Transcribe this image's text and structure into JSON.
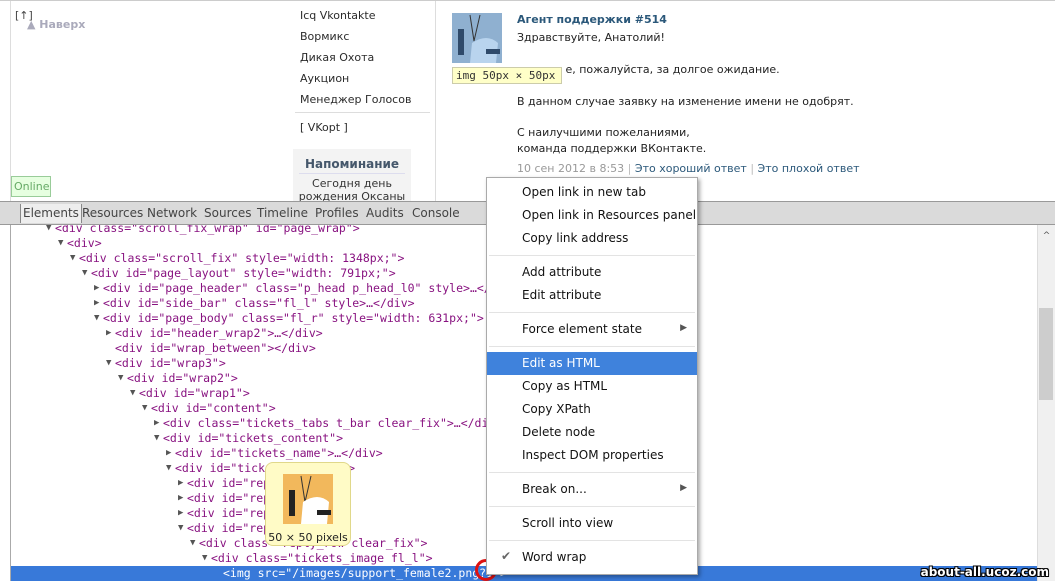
{
  "page": {
    "back_bracket": "[↑]",
    "back_label": "Наверх",
    "menu": [
      "Icq Vkontakte",
      "Вормикс",
      "Дикая Охота",
      "Аукцион",
      "Менеджер Голосов"
    ],
    "vkopt": "[ VKopt ]",
    "reminder_title": "Напоминание",
    "reminder_text": "Сегодня день рождения Оксаны",
    "online": "Online"
  },
  "message": {
    "author": "Агент поддержки #514",
    "lines": [
      "Здравствуйте, Анатолий!",
      "Извините, пожалуйста, за долгое ожидание.",
      "В данном случае заявку на изменение имени не одобрят.",
      "С наилучшими пожеланиями,",
      "команда поддержки ВКонтакте."
    ],
    "date": "10 сен 2012 в 8:53",
    "good": "Это хороший ответ",
    "bad": "Это плохой ответ",
    "img_size_tip": "img 50px × 50px"
  },
  "devtools": {
    "tabs": [
      "Elements",
      "Resources",
      "Network",
      "Sources",
      "Timeline",
      "Profiles",
      "Audits",
      "Console"
    ],
    "active_tab": "Elements",
    "lines": [
      {
        "d": 3,
        "a": "▼",
        "t": "<div class=\"scroll_fix_wrap\" id=\"page_wrap\">"
      },
      {
        "d": 4,
        "a": "▼",
        "t": "<div>"
      },
      {
        "d": 5,
        "a": "▼",
        "t": "<div class=\"scroll_fix\" style=\"width: 1348px;\">"
      },
      {
        "d": 6,
        "a": "▼",
        "t": "<div id=\"page_layout\" style=\"width: 791px;\">"
      },
      {
        "d": 7,
        "a": "▶",
        "t": "<div id=\"page_header\" class=\"p_head p_head_l0\" style>…</div>"
      },
      {
        "d": 7,
        "a": "▶",
        "t": "<div id=\"side_bar\" class=\"fl_l\" style>…</div>"
      },
      {
        "d": 7,
        "a": "▼",
        "t": "<div id=\"page_body\" class=\"fl_r\" style=\"width: 631px;\">"
      },
      {
        "d": 8,
        "a": "▶",
        "t": "<div id=\"header_wrap2\">…</div>"
      },
      {
        "d": 8,
        "a": "",
        "t": "<div id=\"wrap_between\"></div>"
      },
      {
        "d": 8,
        "a": "▼",
        "t": "<div id=\"wrap3\">"
      },
      {
        "d": 9,
        "a": "▼",
        "t": "<div id=\"wrap2\">"
      },
      {
        "d": 10,
        "a": "▼",
        "t": "<div id=\"wrap1\">"
      },
      {
        "d": 11,
        "a": "▼",
        "t": "<div id=\"content\">"
      },
      {
        "d": 12,
        "a": "▶",
        "t": "<div class=\"tickets_tabs t_bar clear_fix\">…</div>"
      },
      {
        "d": 12,
        "a": "▼",
        "t": "<div id=\"tickets_content\">"
      },
      {
        "d": 13,
        "a": "▶",
        "t": "<div id=\"tickets_name\">…</div>"
      },
      {
        "d": 13,
        "a": "▼",
        "t": "<div id=\"tickets_replies\">"
      },
      {
        "d": 14,
        "a": "▶",
        "t": "<div id=\"rep         …</div>"
      },
      {
        "d": 14,
        "a": "▶",
        "t": "<div id=\"rep         …</div>"
      },
      {
        "d": 14,
        "a": "▶",
        "t": "<div id=\"rep         …</div>"
      },
      {
        "d": 14,
        "a": "▼",
        "t": "<div id=\"rep"
      },
      {
        "d": 15,
        "a": "▼",
        "t": "<div class=\"reply_row clear_fix\">"
      },
      {
        "d": 16,
        "a": "▼",
        "t": "<div class=\"tickets_image fl_l\">"
      },
      {
        "d": 17,
        "a": "",
        "t": "<img src=\"/images/support_female2.png?1\">",
        "selected": true
      }
    ],
    "img_tooltip": "50 × 50 pixels"
  },
  "context_menu": {
    "groups": [
      [
        "Open link in new tab",
        "Open link in Resources panel",
        "Copy link address"
      ],
      [
        "Add attribute",
        "Edit attribute"
      ],
      [
        "Force element state"
      ],
      [
        "Edit as HTML",
        "Copy as HTML",
        "Copy XPath",
        "Delete node",
        "Inspect DOM properties"
      ],
      [
        "Break on..."
      ],
      [
        "Scroll into view"
      ],
      [
        "Word wrap"
      ]
    ],
    "highlighted": "Edit as HTML",
    "submenus": [
      "Force element state",
      "Break on..."
    ],
    "checked": "Word wrap"
  },
  "watermark": "about-all.ucoz.com",
  "colors": {
    "selection": "#3879d9",
    "menu_highlight": "#3f82dc",
    "link": "#2b587a"
  }
}
